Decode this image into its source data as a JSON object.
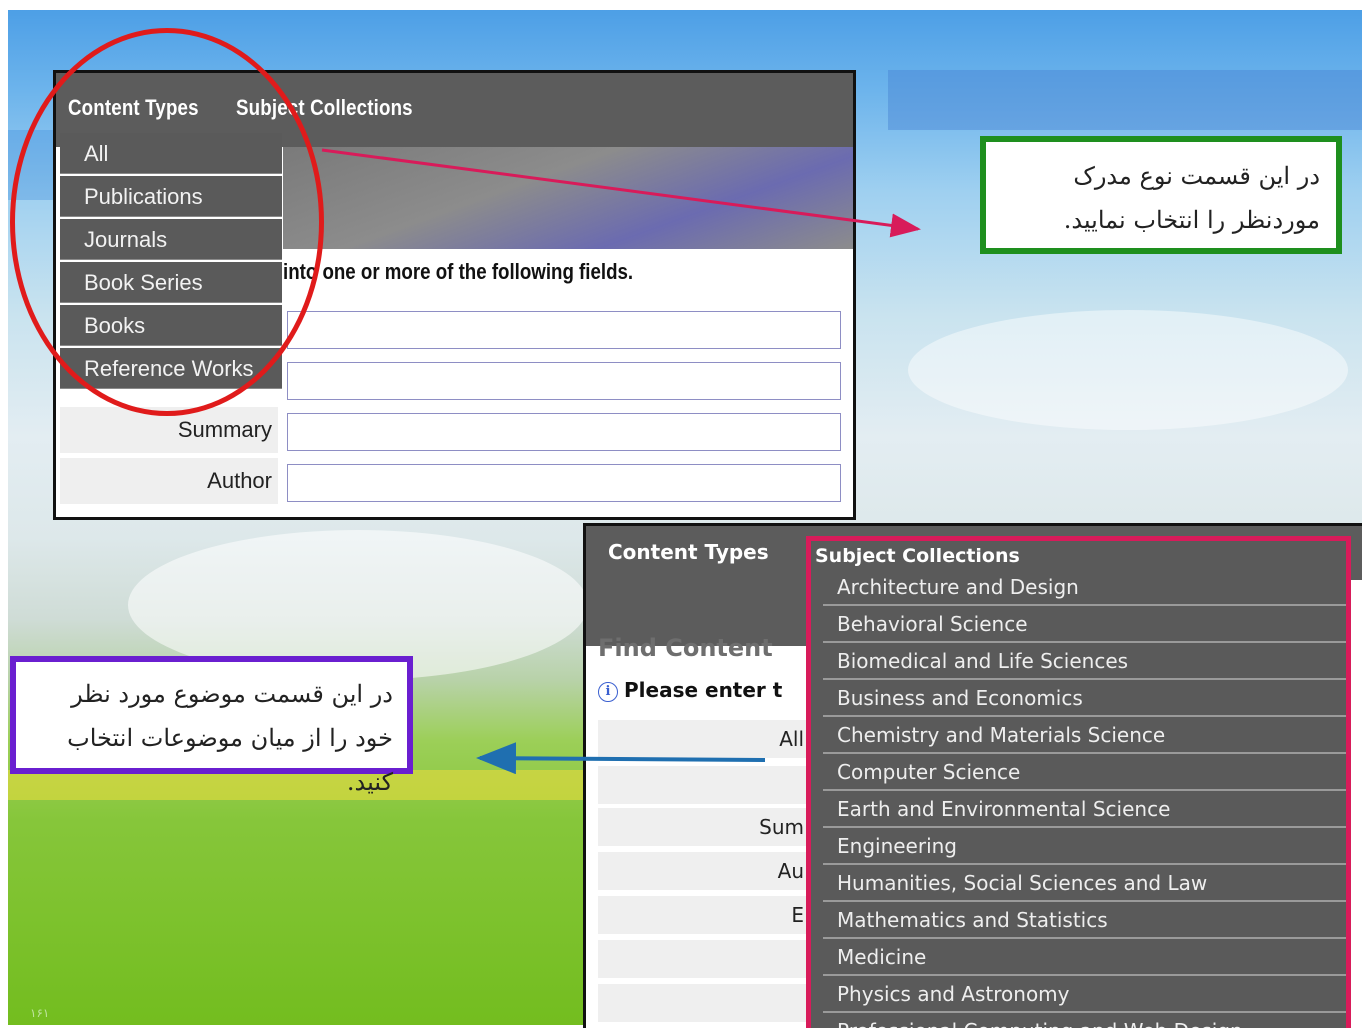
{
  "top_panel": {
    "tabs": [
      "Content Types",
      "Subject Collections"
    ],
    "menu": [
      "All",
      "Publications",
      "Journals",
      "Book Series",
      "Books",
      "Reference Works"
    ],
    "instruction": "into one or more of the following fields.",
    "labels": [
      "Summary",
      "Author"
    ]
  },
  "callouts": {
    "green": "در این قسمت نوع مدرک موردنظر را انتخاب نمایید.",
    "purple": "در این قسمت موضوع مورد نظر خود را از میان موضوعات انتخاب کنید."
  },
  "bottom_panel": {
    "tab_content_types": "Content Types",
    "find_content": "Find Content",
    "please_enter": "Please enter t",
    "labels": [
      "All",
      "Sum",
      "Au",
      "E"
    ],
    "subject_title": "Subject Collections",
    "subjects": [
      "Architecture and Design",
      "Behavioral Science",
      "Biomedical and Life Sciences",
      "Business and Economics",
      "Chemistry and Materials Science",
      "Computer Science",
      "Earth and Environmental Science",
      "Engineering",
      "Humanities, Social Sciences and Law",
      "Mathematics and Statistics",
      "Medicine",
      "Physics and Astronomy",
      "Professional Computing and Web Design"
    ]
  },
  "colors": {
    "red_oval": "#e01b1b",
    "green_border": "#1e8f1e",
    "purple_border": "#6a1fd0",
    "pink_border": "#d81b5a",
    "menu_gray": "#5a5a5a"
  },
  "footer": "۱۶۱"
}
